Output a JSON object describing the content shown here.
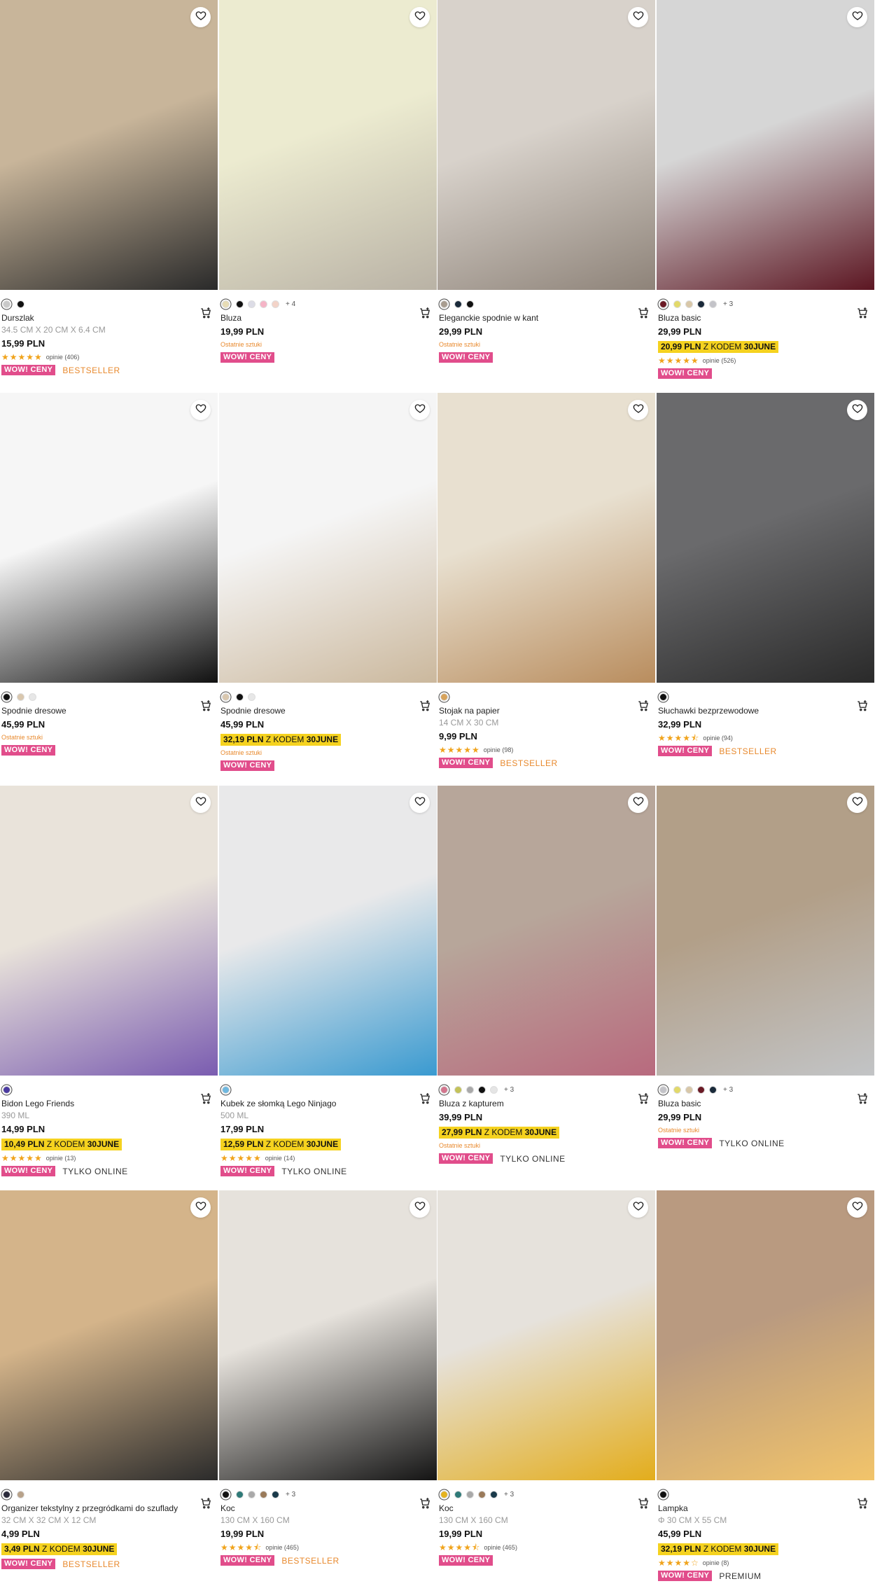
{
  "icons": {
    "favorite": "heart-outline-icon",
    "cart": "add-to-cart-icon"
  },
  "colors": {
    "promo_bg": "#f5d21f",
    "wow_bg": "#e14d8b",
    "bestseller": "#e8892d",
    "stars": "#f0a31b"
  },
  "products": [
    {
      "name": "Durszlak",
      "dims": "34.5 CM X 20 CM X 6.4 CM",
      "price": "15,99 PLN",
      "swatches": [
        "#c9c9c9",
        "#111111"
      ],
      "more": "",
      "promo": null,
      "last": "",
      "stars": 5,
      "reviews": "opinie (406)",
      "wow": "WOW! CENY",
      "tag": "BESTSELLER",
      "tag_type": "best",
      "img": [
        "#c8b59a",
        "#2a2a2a"
      ]
    },
    {
      "name": "Bluza",
      "dims": "",
      "price": "19,99 PLN",
      "swatches": [
        "#e7dcb5",
        "#111111",
        "#dcdce6",
        "#f5b4c6",
        "#f3d3c8"
      ],
      "more": "+ 4",
      "promo": null,
      "last": "Ostatnie sztuki",
      "stars": 0,
      "reviews": "",
      "wow": "WOW! CENY",
      "tag": "",
      "tag_type": "",
      "img": [
        "#ecebd0",
        "#b9b2a5"
      ]
    },
    {
      "name": "Eleganckie spodnie w kant",
      "dims": "",
      "price": "29,99 PLN",
      "swatches": [
        "#a89d90",
        "#1a2a3a",
        "#111111"
      ],
      "more": "",
      "promo": null,
      "last": "Ostatnie sztuki",
      "stars": 0,
      "reviews": "",
      "wow": "WOW! CENY",
      "tag": "",
      "tag_type": "",
      "img": [
        "#d8d2cb",
        "#8e8379"
      ]
    },
    {
      "name": "Bluza basic",
      "dims": "",
      "price": "29,99 PLN",
      "swatches": [
        "#6b1a25",
        "#e2d96a",
        "#d8c7a8",
        "#1a2a3a",
        "#c3c3c8"
      ],
      "more": "+ 3",
      "promo": {
        "price": "20,99 PLN",
        "text": "Z KODEM",
        "code": "30JUNE"
      },
      "last": "",
      "stars": 5,
      "reviews": "opinie (526)",
      "wow": "WOW! CENY",
      "tag": "",
      "tag_type": "",
      "img": [
        "#d6d6d6",
        "#5c1622"
      ]
    },
    {
      "name": "Spodnie dresowe",
      "dims": "",
      "price": "45,99 PLN",
      "swatches": [
        "#111111",
        "#d9c7ae",
        "#e7e7e7"
      ],
      "more": "",
      "promo": null,
      "last": "Ostatnie sztuki",
      "stars": 0,
      "reviews": "",
      "wow": "WOW! CENY",
      "tag": "",
      "tag_type": "",
      "img": [
        "#f6f6f6",
        "#111111"
      ]
    },
    {
      "name": "Spodnie dresowe",
      "dims": "",
      "price": "45,99 PLN",
      "swatches": [
        "#d9c7ae",
        "#111111",
        "#e7e7e7"
      ],
      "more": "",
      "promo": {
        "price": "32,19 PLN",
        "text": "Z KODEM",
        "code": "30JUNE"
      },
      "last": "Ostatnie sztuki",
      "stars": 0,
      "reviews": "",
      "wow": "WOW! CENY",
      "tag": "",
      "tag_type": "",
      "img": [
        "#f5f5f5",
        "#cbb89d"
      ]
    },
    {
      "name": "Stojak na papier",
      "dims": "14 CM X 30 CM",
      "price": "9,99 PLN",
      "swatches": [
        "#d7a35c"
      ],
      "more": "",
      "promo": null,
      "last": "",
      "stars": 5,
      "reviews": "opinie (98)",
      "wow": "WOW! CENY",
      "tag": "BESTSELLER",
      "tag_type": "best",
      "img": [
        "#e8e0d0",
        "#b98d5e"
      ]
    },
    {
      "name": "Słuchawki bezprzewodowe",
      "dims": "",
      "price": "32,99 PLN",
      "swatches": [
        "#111111"
      ],
      "more": "",
      "promo": null,
      "last": "",
      "stars": 4.5,
      "reviews": "opinie (94)",
      "wow": "WOW! CENY",
      "tag": "BESTSELLER",
      "tag_type": "best",
      "img": [
        "#6a6a6c",
        "#2a2a2a"
      ]
    },
    {
      "name": "Bidon Lego Friends",
      "dims": "390 ML",
      "price": "14,99 PLN",
      "swatches": [
        "#4a3aa0"
      ],
      "more": "",
      "promo": {
        "price": "10,49 PLN",
        "text": "Z KODEM",
        "code": "30JUNE"
      },
      "last": "",
      "stars": 5,
      "reviews": "opinie (13)",
      "wow": "WOW! CENY",
      "tag": "TYLKO ONLINE",
      "tag_type": "online",
      "img": [
        "#e9e3da",
        "#7a5cb0"
      ]
    },
    {
      "name": "Kubek ze słomką Lego Ninjago",
      "dims": "500 ML",
      "price": "17,99 PLN",
      "swatches": [
        "#6fb8e0"
      ],
      "more": "",
      "promo": {
        "price": "12,59 PLN",
        "text": "Z KODEM",
        "code": "30JUNE"
      },
      "last": "",
      "stars": 5,
      "reviews": "opinie (14)",
      "wow": "WOW! CENY",
      "tag": "TYLKO ONLINE",
      "tag_type": "online",
      "img": [
        "#e9e9ea",
        "#3a9ad0"
      ]
    },
    {
      "name": "Bluza z kapturem",
      "dims": "",
      "price": "39,99 PLN",
      "swatches": [
        "#d3768e",
        "#c3c25a",
        "#a9a9a9",
        "#111111",
        "#e5e5e5"
      ],
      "more": "+ 3",
      "promo": {
        "price": "27,99 PLN",
        "text": "Z KODEM",
        "code": "30JUNE"
      },
      "last": "Ostatnie sztuki",
      "stars": 0,
      "reviews": "",
      "wow": "WOW! CENY",
      "tag": "TYLKO ONLINE",
      "tag_type": "online",
      "img": [
        "#b7a69a",
        "#b86a7e"
      ]
    },
    {
      "name": "Bluza basic",
      "dims": "",
      "price": "29,99 PLN",
      "swatches": [
        "#c3c3c8",
        "#e2d96a",
        "#d8c7a8",
        "#6b1a25",
        "#1a2a3a"
      ],
      "more": "+ 3",
      "promo": null,
      "last": "Ostatnie sztuki",
      "stars": 0,
      "reviews": "",
      "wow": "WOW! CENY",
      "tag": "TYLKO ONLINE",
      "tag_type": "online",
      "img": [
        "#b29f88",
        "#c2c4c6"
      ]
    },
    {
      "name": "Organizer tekstylny z przegródkami do szuflady",
      "dims": "32 CM X 32 CM X 12 CM",
      "price": "4,99 PLN",
      "swatches": [
        "#2a2a3a",
        "#b8a28a"
      ],
      "more": "",
      "promo": {
        "price": "3,49 PLN",
        "text": "Z KODEM",
        "code": "30JUNE"
      },
      "last": "",
      "stars": 0,
      "reviews": "",
      "wow": "WOW! CENY",
      "tag": "BESTSELLER",
      "tag_type": "best",
      "img": [
        "#d4b48a",
        "#2b2b2b"
      ]
    },
    {
      "name": "Koc",
      "dims": "130 CM X 160 CM",
      "price": "19,99 PLN",
      "swatches": [
        "#111111",
        "#2f7a78",
        "#a9a9a9",
        "#9a7a5a",
        "#1a3a4a"
      ],
      "more": "+ 3",
      "promo": null,
      "last": "",
      "stars": 4.5,
      "reviews": "opinie (465)",
      "wow": "WOW! CENY",
      "tag": "BESTSELLER",
      "tag_type": "best",
      "img": [
        "#e6e2dc",
        "#141414"
      ]
    },
    {
      "name": "Koc",
      "dims": "130 CM X 160 CM",
      "price": "19,99 PLN",
      "swatches": [
        "#e5b320",
        "#2f7a78",
        "#a9a9a9",
        "#9a7a5a",
        "#1a3a4a"
      ],
      "more": "+ 3",
      "promo": null,
      "last": "",
      "stars": 4.5,
      "reviews": "opinie (465)",
      "wow": "WOW! CENY",
      "tag": "",
      "tag_type": "",
      "img": [
        "#e6e2dc",
        "#e3ad1c"
      ]
    },
    {
      "name": "Lampka",
      "dims": "Φ 30 CM X 55 CM",
      "price": "45,99 PLN",
      "swatches": [
        "#111111"
      ],
      "more": "",
      "promo": {
        "price": "32,19 PLN",
        "text": "Z KODEM",
        "code": "30JUNE"
      },
      "last": "",
      "stars": 4,
      "reviews": "opinie (8)",
      "wow": "WOW! CENY",
      "tag": "PREMIUM",
      "tag_type": "premium",
      "img": [
        "#b99a80",
        "#f2c46a"
      ]
    }
  ]
}
